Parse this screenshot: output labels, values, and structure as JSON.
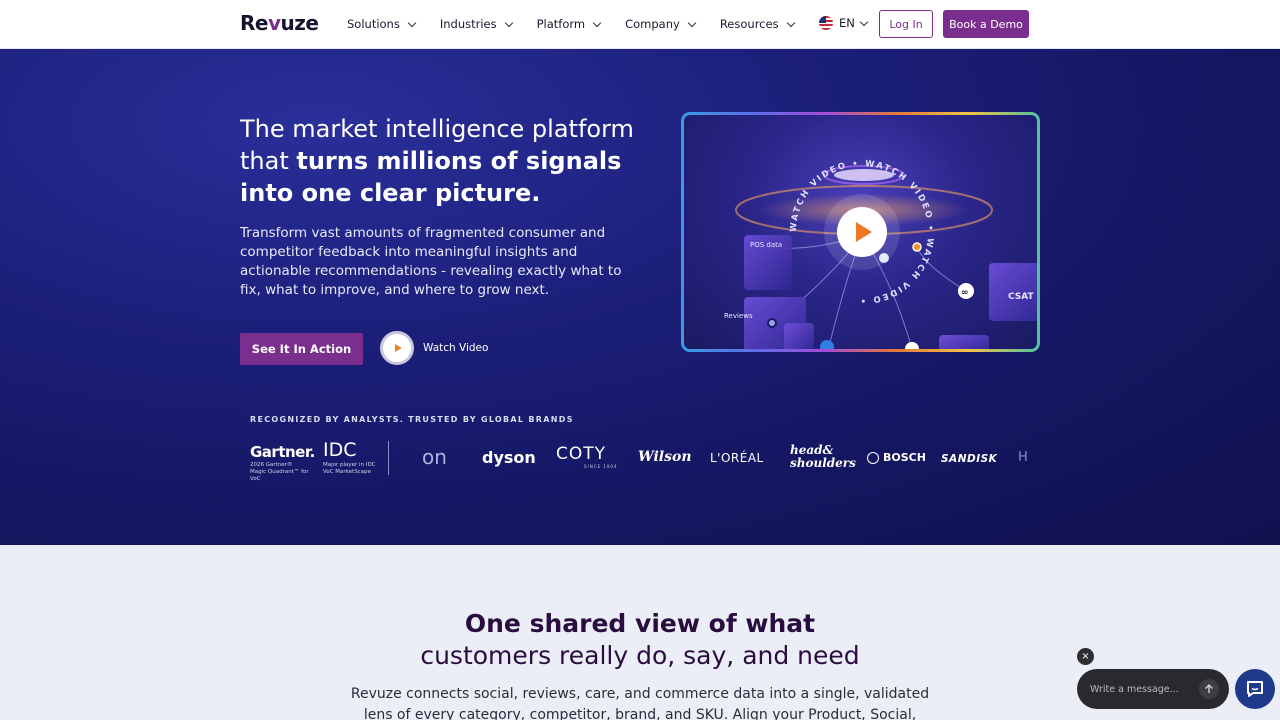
{
  "nav": {
    "logo": "Revuze",
    "items": [
      {
        "label": "Solutions"
      },
      {
        "label": "Industries"
      },
      {
        "label": "Platform"
      },
      {
        "label": "Company"
      },
      {
        "label": "Resources"
      }
    ],
    "language": "EN",
    "login_label": "Log In",
    "demo_label": "Book a Demo"
  },
  "hero": {
    "title_regular": "The market intelligence platform that ",
    "title_bold": "turns millions of signals into one clear picture.",
    "description": "Transform vast amounts of fragmented consumer and competitor feedback into meaningful insights and actionable recommendations - revealing exactly what to fix, what to improve, and where to grow next.",
    "cta_label": "See It In Action",
    "watch_label": "Watch Video",
    "video": {
      "ring_text": "WATCH VIDEO • WATCH VIDEO • WATCH VIDEO •",
      "labels": [
        "POS data",
        "Reviews",
        "CSAT"
      ]
    }
  },
  "analysts": {
    "heading": "RECOGNIZED BY ANALYSTS. TRUSTED BY GLOBAL BRANDS",
    "gartner": "Gartner.",
    "gartner_sub": "2026 Gartner® Magic Quadrant™ for VoC",
    "idc": "IDC",
    "idc_sub": "Major player in IDC VoC MarketScape",
    "brands": {
      "on": "on",
      "dyson": "dyson",
      "coty": "COTY",
      "coty_sub": "SINCE 1904",
      "wilson": "Wilson",
      "loreal": "L'ORÉAL",
      "hs": "head& shoulders",
      "bosch": "BOSCH",
      "sandisk": "SANDISK",
      "partial": "H"
    }
  },
  "section": {
    "title_line1": "One shared view of what",
    "title_line2": "customers really do, say, and need",
    "description": "Revuze connects social, reviews, care, and commerce data into a single, validated lens of every category, competitor, brand, and SKU. Align your Product, Social, Insights,"
  },
  "chat": {
    "close": "×",
    "placeholder": "Write a message..."
  },
  "colors": {
    "brand": "#7a2e8e",
    "hero_bg": "#1c1f7a",
    "heading": "#2a0d3f"
  }
}
